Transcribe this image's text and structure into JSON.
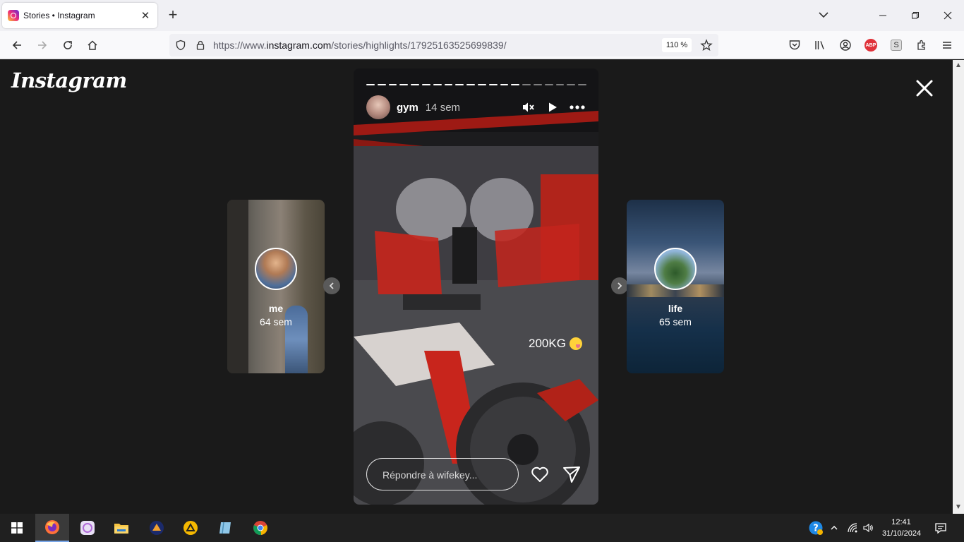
{
  "browser": {
    "tab_title": "Stories • Instagram",
    "url_prefix": "https://www.",
    "url_domain": "instagram.com",
    "url_path": "/stories/highlights/17925163525699839/",
    "zoom": "110 %"
  },
  "page": {
    "logo": "Instagram"
  },
  "story": {
    "username": "gym",
    "time": "14 sem",
    "progress_segments_total": 20,
    "progress_segments_done": 14,
    "overlay_text": "200KG",
    "reply_placeholder": "Répondre à wifekey..."
  },
  "highlights": {
    "previous": {
      "name": "me",
      "time": "64 sem"
    },
    "next": {
      "name": "life",
      "time": "65 sem"
    }
  },
  "taskbar": {
    "time": "12:41",
    "date": "31/10/2024"
  },
  "colors": {
    "gym_red": "#c8251c",
    "accent": "#0a84ff"
  },
  "icons": [
    "instagram-favicon",
    "close-icon",
    "plus-icon",
    "chevron-down-icon",
    "minimize-icon",
    "restore-icon",
    "back-icon",
    "forward-icon",
    "reload-icon",
    "home-icon",
    "shield-icon",
    "lock-icon",
    "star-icon",
    "pocket-icon",
    "library-icon",
    "account-icon",
    "adblock-icon",
    "extension-s-icon",
    "extensions-icon",
    "menu-icon",
    "mute-icon",
    "play-icon",
    "more-icon",
    "heart-icon",
    "send-icon",
    "windows-start-icon",
    "firefox-icon",
    "folder-icon",
    "chrome-icon",
    "help-icon",
    "wifi-icon",
    "volume-icon",
    "notification-icon"
  ]
}
